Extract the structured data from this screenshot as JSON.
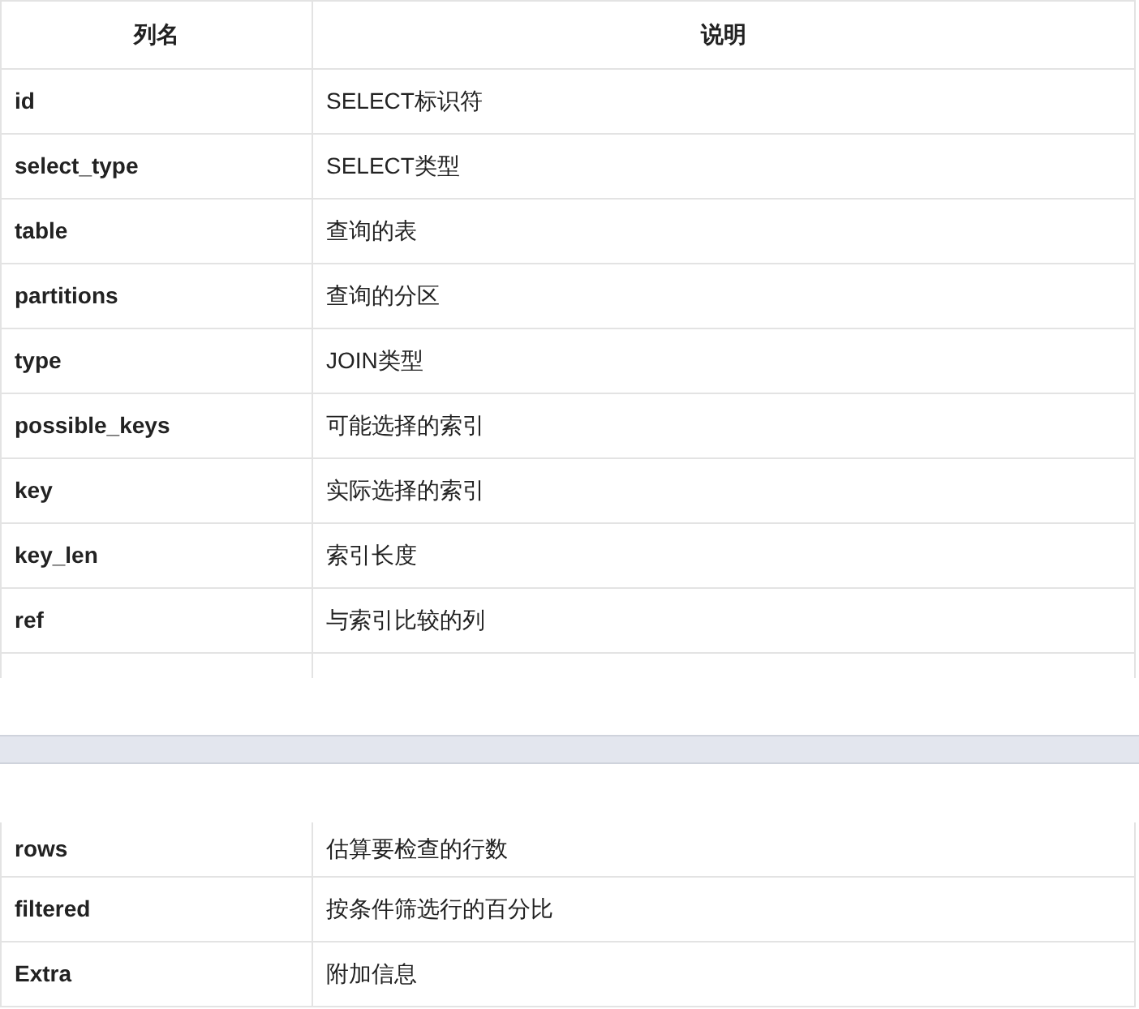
{
  "table": {
    "columns": [
      "列名",
      "说明"
    ],
    "rows": [
      {
        "name": "id",
        "description": "SELECT标识符"
      },
      {
        "name": "select_type",
        "description": "SELECT类型"
      },
      {
        "name": "table",
        "description": "查询的表"
      },
      {
        "name": "partitions",
        "description": "查询的分区"
      },
      {
        "name": "type",
        "description": "JOIN类型"
      },
      {
        "name": "possible_keys",
        "description": "可能选择的索引"
      },
      {
        "name": "key",
        "description": "实际选择的索引"
      },
      {
        "name": "key_len",
        "description": "索引长度"
      },
      {
        "name": "ref",
        "description": "与索引比较的列"
      }
    ]
  },
  "table_continued": {
    "rows": [
      {
        "name": "rows",
        "description": "估算要检查的行数"
      },
      {
        "name": "filtered",
        "description": "按条件筛选行的百分比"
      },
      {
        "name": "Extra",
        "description": "附加信息"
      }
    ]
  }
}
